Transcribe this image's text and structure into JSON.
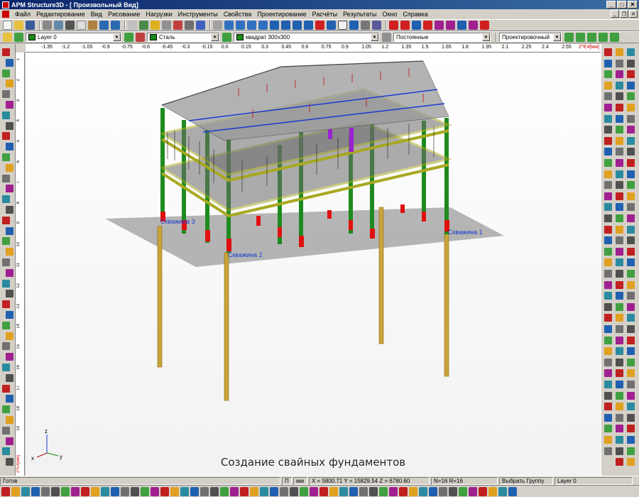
{
  "window": {
    "title": "APM Structure3D - [ Произвольный Вид]"
  },
  "menu": [
    "Файл",
    "Редактирование",
    "Вид",
    "Рисование",
    "Нагрузки",
    "Инструменты",
    "Свойства",
    "Проектирование",
    "Расчёты",
    "Результаты",
    "Окно",
    "Справка"
  ],
  "toolbar2": {
    "layer": "Layer 0",
    "material": "Сталь",
    "section": "квадрат 300x300",
    "load_case": "Постоянные",
    "mode": "Проектировочный"
  },
  "ruler_h": {
    "ticks": [
      "-1.35",
      "-1.2",
      "-1.05",
      "-0.9",
      "-0.75",
      "-0.6",
      "-0.45",
      "-0.3",
      "-0.15",
      "0.0",
      "0.15",
      "0.3",
      "0.45",
      "0.6",
      "0.75",
      "0.9",
      "1.05",
      "1.2",
      "1.35",
      "1.5",
      "1.65",
      "1.8",
      "1.95",
      "2.1",
      "2.25",
      "2.4",
      "2.55"
    ],
    "units": "2^E4[мм]"
  },
  "ruler_v": {
    "ticks": [
      "1",
      "2",
      "3",
      "4",
      "5",
      "6",
      "7",
      "8",
      "9",
      "10",
      "11",
      "12",
      "13",
      "14",
      "15",
      "16",
      "17",
      "18",
      "19"
    ],
    "units": "2^E4[мм]"
  },
  "viewport": {
    "boreholes": [
      "Скважина 3",
      "Скважина 2",
      "Скважина 1"
    ],
    "axes": {
      "z": "z",
      "x": "x",
      "y": "y"
    },
    "caption": "Создание свайных фундаментов"
  },
  "status": {
    "ready": "Готов",
    "p": "П",
    "units": "мм",
    "coords": "X = 5800.71 Y = 15829.54 Z = 6780.60",
    "counts": "N=16 R=16",
    "select_mode": "Выбрать Группу",
    "layer": "Layer 0"
  },
  "colors": {
    "column": "#1f8a1f",
    "pile": "#c8a43a",
    "footing": "#e01010",
    "beam_yellow": "#a8a820",
    "roof": "#9a9a9a",
    "accent_blue": "#1a3ad0"
  }
}
